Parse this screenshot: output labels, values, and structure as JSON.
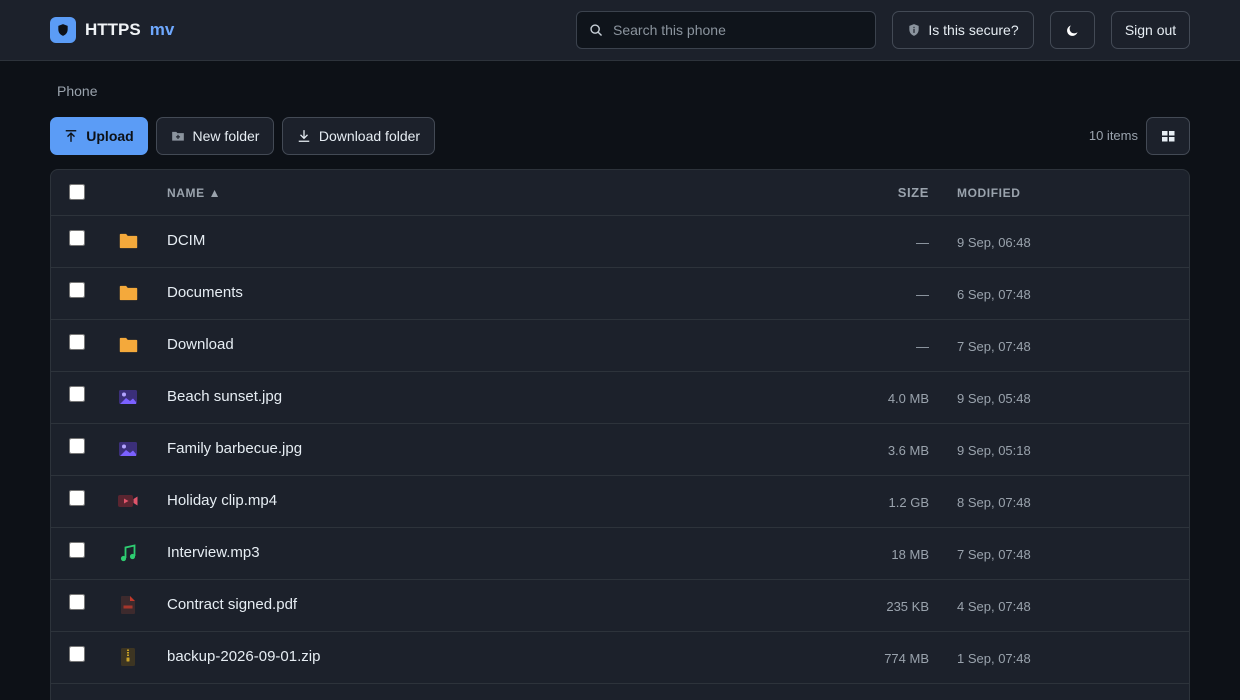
{
  "header": {
    "brand": "HTTPS",
    "brand_tag": "mv",
    "search_placeholder": "Search this phone",
    "secure_label": "Is this secure?",
    "signout_label": "Sign out"
  },
  "breadcrumb": "Phone",
  "toolbar": {
    "upload_label": "Upload",
    "new_folder_label": "New folder",
    "download_folder_label": "Download folder",
    "items_count": "10 items"
  },
  "table": {
    "col_name": "NAME ▲",
    "col_size": "SIZE",
    "col_modified": "MODIFIED",
    "rows": [
      {
        "name": "DCIM",
        "size": "—",
        "modified": "9 Sep, 06:48",
        "icon": "folder-icon"
      },
      {
        "name": "Documents",
        "size": "—",
        "modified": "6 Sep, 07:48",
        "icon": "folder-icon"
      },
      {
        "name": "Download",
        "size": "—",
        "modified": "7 Sep, 07:48",
        "icon": "folder-icon"
      },
      {
        "name": "Beach sunset.jpg",
        "size": "4.0 MB",
        "modified": "9 Sep, 05:48",
        "icon": "image-icon"
      },
      {
        "name": "Family barbecue.jpg",
        "size": "3.6 MB",
        "modified": "9 Sep, 05:18",
        "icon": "image-icon"
      },
      {
        "name": "Holiday clip.mp4",
        "size": "1.2 GB",
        "modified": "8 Sep, 07:48",
        "icon": "video-icon"
      },
      {
        "name": "Interview.mp3",
        "size": "18 MB",
        "modified": "7 Sep, 07:48",
        "icon": "audio-icon"
      },
      {
        "name": "Contract signed.pdf",
        "size": "235 KB",
        "modified": "4 Sep, 07:48",
        "icon": "pdf-icon"
      },
      {
        "name": "backup-2026-09-01.zip",
        "size": "774 MB",
        "modified": "1 Sep, 07:48",
        "icon": "zip-icon"
      }
    ]
  },
  "colors": {
    "accent": "#5b9cf6",
    "folder": "#f4a93b",
    "image": "#7b61ff",
    "video": "#e0556b",
    "audio": "#2ecc71",
    "pdf": "#c0392b",
    "zip": "#c9a227"
  }
}
